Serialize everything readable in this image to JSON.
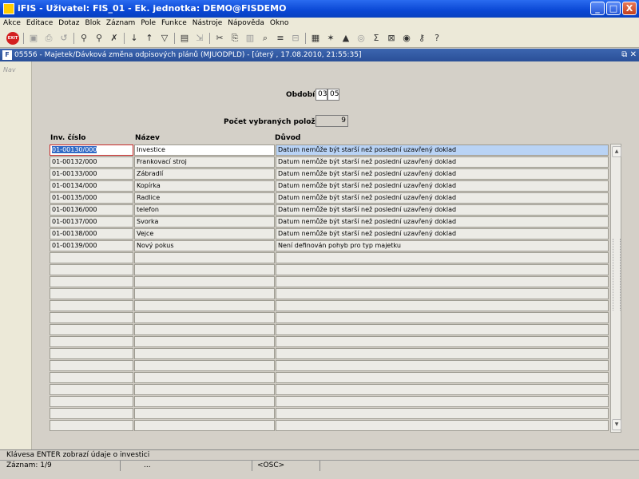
{
  "window": {
    "title": "iFIS - Uživatel: FIS_01 - Ek. jednotka: DEMO@FISDEMO",
    "minimize_glyph": "_",
    "maximize_glyph": "□",
    "close_glyph": "X"
  },
  "menu": [
    "Akce",
    "Editace",
    "Dotaz",
    "Blok",
    "Záznam",
    "Pole",
    "Funkce",
    "Nástroje",
    "Nápověda",
    "Okno"
  ],
  "toolbar": {
    "exit_label": "EXIT",
    "icons": [
      "save-icon",
      "print-icon",
      "clear-icon",
      "query-enter-icon",
      "query-execute-icon",
      "query-cancel-icon",
      "sort-asc-icon",
      "sort-desc-icon",
      "filter-icon",
      "print-preview-icon",
      "export-icon",
      "cut-icon",
      "copy-icon",
      "paste-icon",
      "find-icon",
      "insert-record-icon",
      "delete-record-icon",
      "calculator-icon",
      "tools-icon",
      "warning-icon",
      "disk-icon",
      "sum-icon",
      "excel-icon",
      "globe-icon",
      "key-icon",
      "help-icon"
    ]
  },
  "inner_window": {
    "title": "05556 - Majetek/Dávková změna odpisových plánů (MJUODPLD) - [úterý , 17.08.2010, 21:55:35]",
    "controls": "⧉ ✕"
  },
  "nav": {
    "label": "Nav"
  },
  "form": {
    "obdobi_label": "Období",
    "obdobi_month": "03",
    "obdobi_year": "05",
    "count_label": "Počet vybraných položek",
    "count_value": "9"
  },
  "table": {
    "headers": [
      "Inv. číslo",
      "Název",
      "Důvod"
    ],
    "rows": [
      {
        "inv": "01-00130/000",
        "nazev": "Investice",
        "duvod": "Datum nemůže být starší než poslední uzavřený doklad"
      },
      {
        "inv": "01-00132/000",
        "nazev": "Frankovací stroj",
        "duvod": "Datum nemůže být starší než poslední uzavřený doklad"
      },
      {
        "inv": "01-00133/000",
        "nazev": "Zábradlí",
        "duvod": "Datum nemůže být starší než poslední uzavřený doklad"
      },
      {
        "inv": "01-00134/000",
        "nazev": "Kopírka",
        "duvod": "Datum nemůže být starší než poslední uzavřený doklad"
      },
      {
        "inv": "01-00135/000",
        "nazev": "Radlice",
        "duvod": "Datum nemůže být starší než poslední uzavřený doklad"
      },
      {
        "inv": "01-00136/000",
        "nazev": "telefon",
        "duvod": "Datum nemůže být starší než poslední uzavřený doklad"
      },
      {
        "inv": "01-00137/000",
        "nazev": "Svorka",
        "duvod": "Datum nemůže být starší než poslední uzavřený doklad"
      },
      {
        "inv": "01-00138/000",
        "nazev": "Vejce",
        "duvod": "Datum nemůže být starší než poslední uzavřený doklad"
      },
      {
        "inv": "01-00139/000",
        "nazev": "Nový pokus",
        "duvod": "Není definován pohyb pro typ majetku"
      },
      {
        "inv": "",
        "nazev": "",
        "duvod": ""
      },
      {
        "inv": "",
        "nazev": "",
        "duvod": ""
      },
      {
        "inv": "",
        "nazev": "",
        "duvod": ""
      },
      {
        "inv": "",
        "nazev": "",
        "duvod": ""
      },
      {
        "inv": "",
        "nazev": "",
        "duvod": ""
      },
      {
        "inv": "",
        "nazev": "",
        "duvod": ""
      },
      {
        "inv": "",
        "nazev": "",
        "duvod": ""
      },
      {
        "inv": "",
        "nazev": "",
        "duvod": ""
      },
      {
        "inv": "",
        "nazev": "",
        "duvod": ""
      },
      {
        "inv": "",
        "nazev": "",
        "duvod": ""
      },
      {
        "inv": "",
        "nazev": "",
        "duvod": ""
      },
      {
        "inv": "",
        "nazev": "",
        "duvod": ""
      },
      {
        "inv": "",
        "nazev": "",
        "duvod": ""
      },
      {
        "inv": "",
        "nazev": "",
        "duvod": ""
      },
      {
        "inv": "",
        "nazev": "",
        "duvod": ""
      }
    ]
  },
  "status": {
    "hint": "Klávesa ENTER zobrazí údaje o investici",
    "record": "Záznam: 1/9",
    "dots": "...",
    "mode": "<OSC>"
  },
  "colors": {
    "title_bar": "#0a47d4",
    "inner_title": "#2a4f98",
    "selection": "#316ac5",
    "active_row": "#b9d3f5",
    "focus_border": "#c62828"
  }
}
